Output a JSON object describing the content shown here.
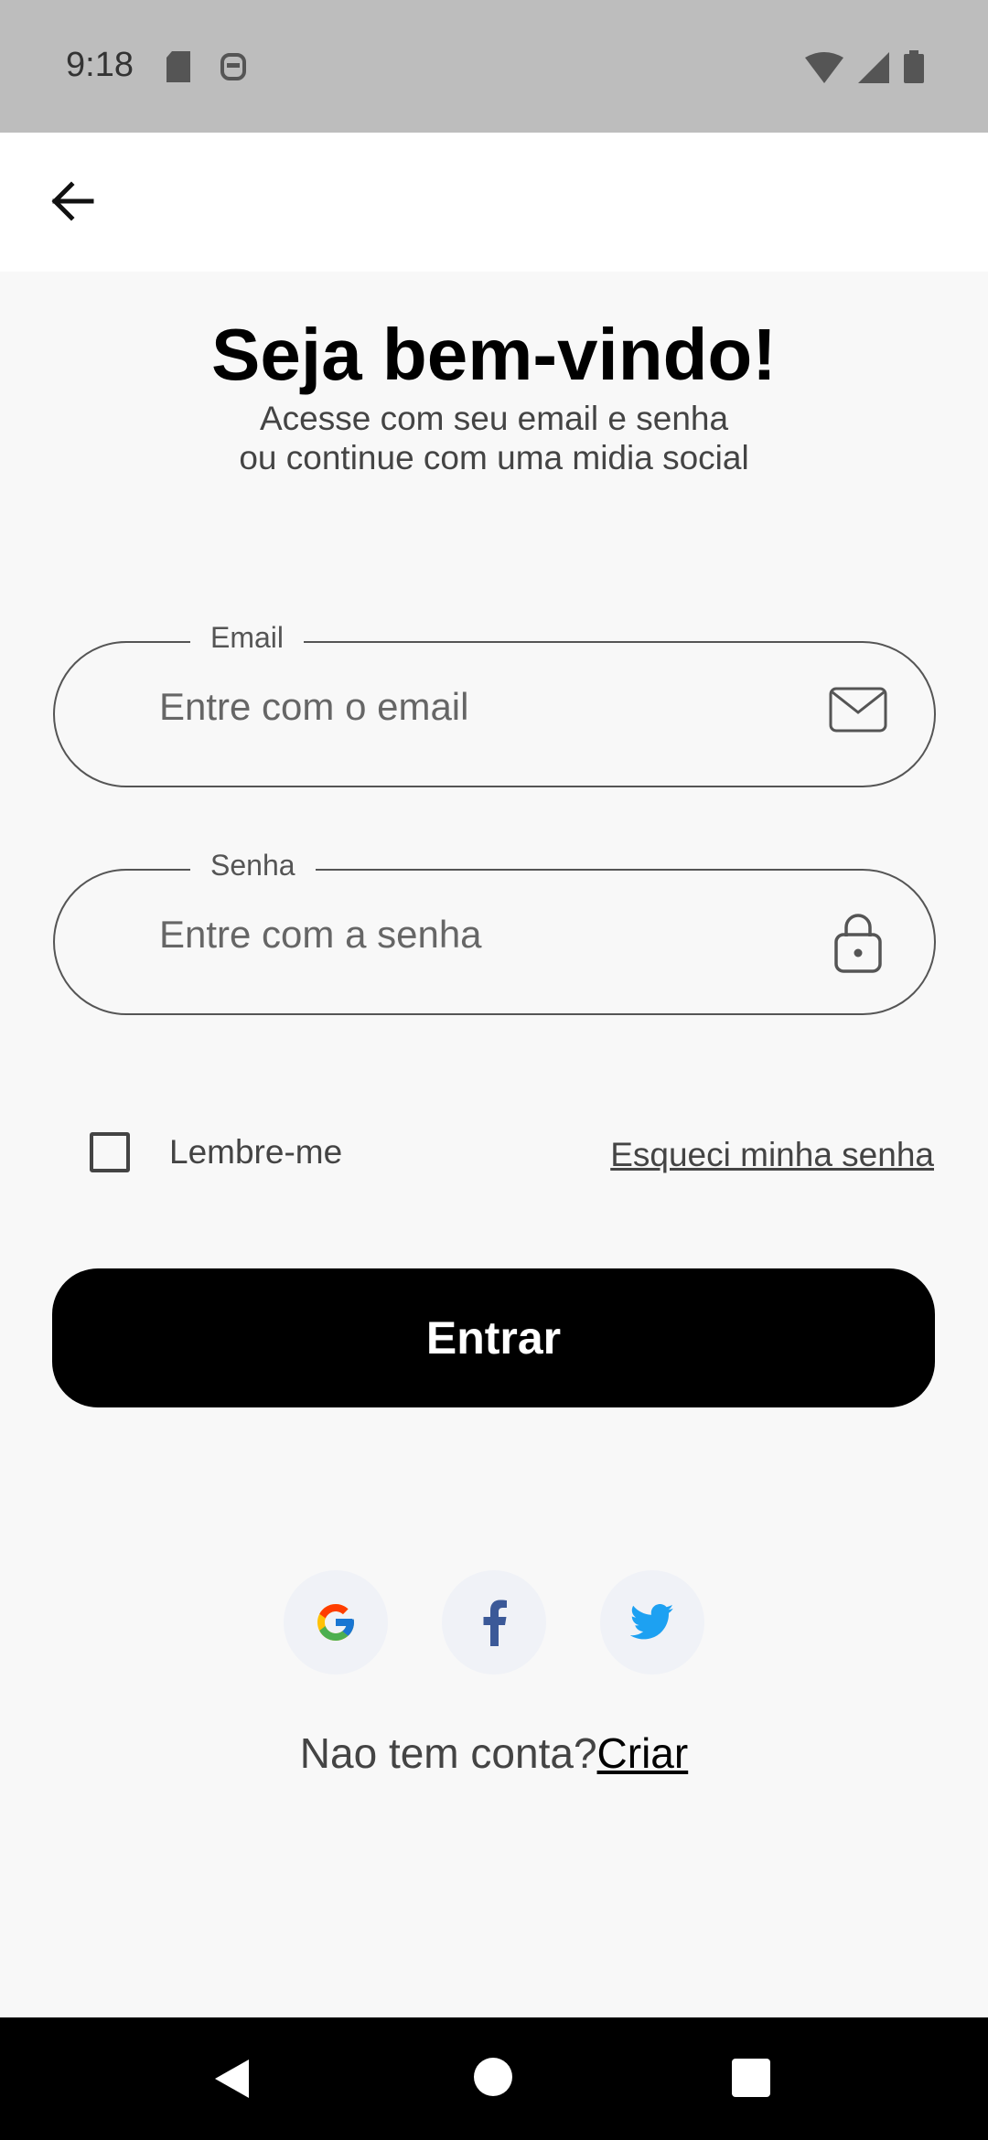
{
  "status": {
    "time": "9:18"
  },
  "welcome": {
    "title": "Seja bem-vindo!",
    "subtitle_line1": "Acesse com seu email e senha",
    "subtitle_line2": "ou continue com uma midia social"
  },
  "email_field": {
    "label": "Email",
    "placeholder": "Entre com o email",
    "icon": "mail-icon"
  },
  "password_field": {
    "label": "Senha",
    "placeholder": "Entre com a senha",
    "icon": "lock-icon"
  },
  "remember_me": {
    "label": "Lembre-me",
    "checked": false
  },
  "forgot_password": "Esqueci minha senha",
  "submit_label": "Entrar",
  "social_buttons": [
    "google",
    "facebook",
    "twitter"
  ],
  "signup": {
    "prompt": "Nao tem conta?",
    "link": "Criar"
  },
  "colors": {
    "primary_button": "#000000",
    "background": "#f8f8f8",
    "status_bar": "#bdbdbd",
    "twitter": "#1da1f2",
    "facebook": "#3b5998"
  }
}
